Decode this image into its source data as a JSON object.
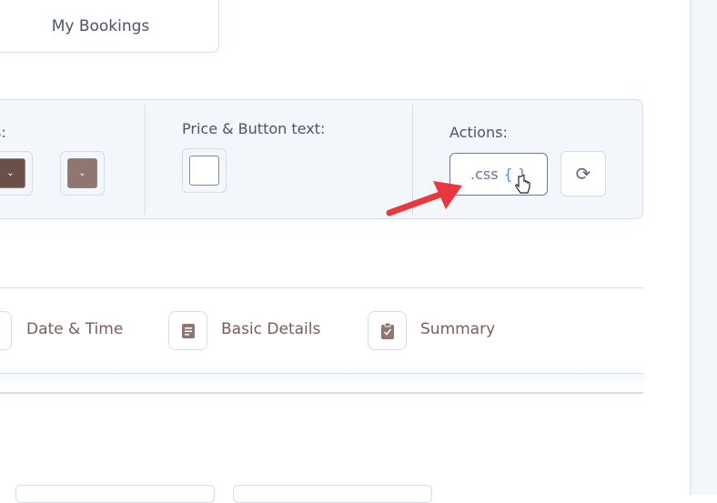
{
  "top_tab": {
    "label": "My Bookings"
  },
  "customize_panel": {
    "colors_label_partial": "s:",
    "swatches": [
      {
        "color": "#6b5048"
      },
      {
        "color": "#917570"
      }
    ],
    "price_label": "Price & Button text:",
    "price_swatch_color": "#ffffff",
    "actions_label": "Actions:",
    "css_button": {
      "label": ".css",
      "braces": "{ }"
    },
    "refresh_icon": "refresh-icon"
  },
  "steps": [
    {
      "label": "Date & Time",
      "icon": "calendar-icon"
    },
    {
      "label": "Basic Details",
      "icon": "document-icon"
    },
    {
      "label": "Summary",
      "icon": "clipboard-check-icon"
    }
  ],
  "colors": {
    "accent": "#917570",
    "arrow": "#e8383d",
    "border": "#d5dcea",
    "panel_bg": "#f3f6fb"
  }
}
